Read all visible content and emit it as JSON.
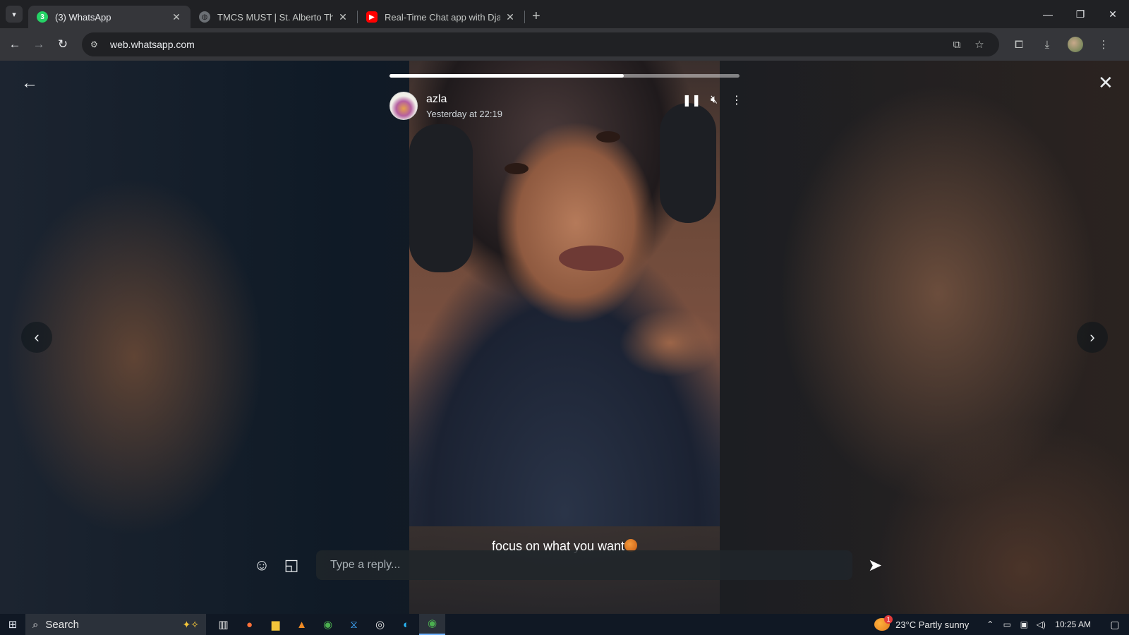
{
  "browser": {
    "tabs": [
      {
        "label": "(3) WhatsApp",
        "favicon": "whatsapp-icon",
        "color": "#25d366",
        "badge": "3"
      },
      {
        "label": "TMCS MUST | St. Alberto The G",
        "favicon": "globe-icon"
      },
      {
        "label": "Real-Time Chat app with Djang",
        "favicon": "youtube-icon",
        "color": "#ff0000"
      }
    ],
    "new_tab": "+",
    "url": "web.whatsapp.com"
  },
  "status": {
    "progress": 0.67,
    "contact_name": "azla",
    "timestamp": "Yesterday at 22:19",
    "caption": "focus on what you want",
    "caption_emoji": "basketball-icon",
    "reply_placeholder": "Type a reply..."
  },
  "taskbar": {
    "search_label": "Search",
    "weather": "23°C  Partly sunny",
    "weather_badge": "1",
    "time": "10:25 AM"
  },
  "colors": {
    "accent": "#25d366",
    "chrome_dark": "#202124",
    "chrome_toolbar": "#35363a",
    "taskbar": "#101824"
  }
}
